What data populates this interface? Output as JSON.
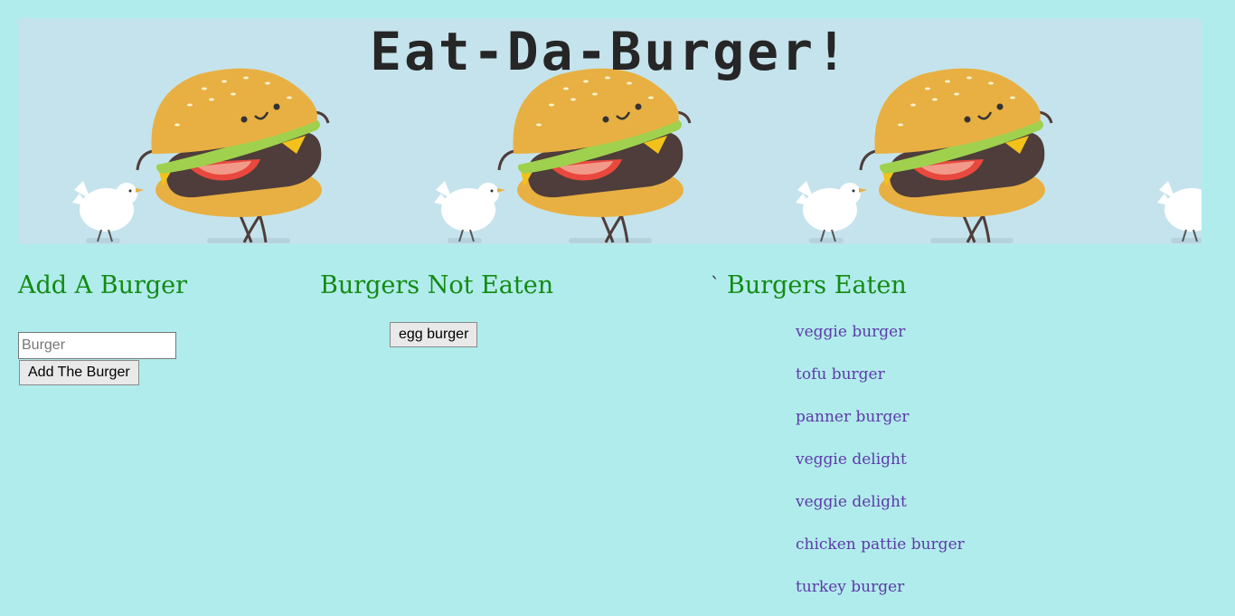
{
  "banner": {
    "title": "Eat-Da-Burger!"
  },
  "add_section": {
    "heading": "Add A Burger",
    "input_placeholder": "Burger",
    "input_value": "",
    "button_label": "Add The Burger"
  },
  "not_eaten_section": {
    "heading": "Burgers Not Eaten",
    "items": [
      "egg burger"
    ]
  },
  "eaten_section": {
    "stray_mark": "`",
    "heading": "Burgers Eaten",
    "items": [
      "veggie burger",
      "tofu burger",
      "panner burger",
      "veggie delight",
      "veggie delight",
      "chicken pattie burger",
      "turkey burger"
    ]
  },
  "colors": {
    "page_background": "#b0ecec",
    "banner_background": "#c5e3ec",
    "heading_green": "#138a13",
    "eaten_item_purple": "#5d3aa8",
    "bun": "#e8b042",
    "patty": "#4e3d3a"
  }
}
